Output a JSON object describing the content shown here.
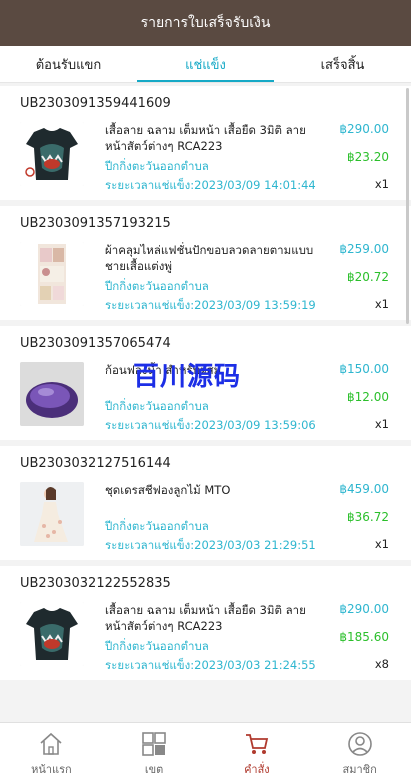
{
  "header": {
    "title": "รายการใบเสร็จรับเงิน"
  },
  "tabs": [
    {
      "label": "ต้อนรับแขก",
      "active": false
    },
    {
      "label": "แช่แข็ง",
      "active": true
    },
    {
      "label": "เสร็จสิ้น",
      "active": false
    }
  ],
  "orders": [
    {
      "id": "UB2303091359441609",
      "name": "เสื้อลาย ฉลาม เต็มหน้า เสื้อยืด 3มิติ ลายหน้าสัตว์ต่างๆ RCA223",
      "ship": "ปีกกิ่งตะวันออกตำบล",
      "time": "ระยะเวลาแช่แข็ง:2023/03/09 14:01:44",
      "price": "฿290.00",
      "commission": "฿23.20",
      "qty": "x1",
      "thumb_icon": "shark-shirt-image"
    },
    {
      "id": "UB2303091357193215",
      "name": "ผ้าคลุมไหล่แฟชั่นปักขอบลวดลายตามแบบ ชายเสื้อแต่งพู่",
      "ship": "ปีกกิ่งตะวันออกตำบล",
      "time": "ระยะเวลาแช่แข็ง:2023/03/09 13:59:19",
      "price": "฿259.00",
      "commission": "฿20.72",
      "qty": "x1",
      "thumb_icon": "shawl-image"
    },
    {
      "id": "UB2303091357065474",
      "name": "ก้อนฟองน้ำ สำหรับผสม",
      "ship": "ปีกกิ่งตะวันออกตำบล",
      "time": "ระยะเวลาแช่แข็ง:2023/03/09 13:59:06",
      "price": "฿150.00",
      "commission": "฿12.00",
      "qty": "x1",
      "thumb_icon": "sponge-image"
    },
    {
      "id": "UB2303032127516144",
      "name": "ชุดเดรสชีฟองลูกไม้ MTO",
      "ship": "ปีกกิ่งตะวันออกตำบล",
      "time": "ระยะเวลาแช่แข็ง:2023/03/03 21:29:51",
      "price": "฿459.00",
      "commission": "฿36.72",
      "qty": "x1",
      "thumb_icon": "dress-image"
    },
    {
      "id": "UB2303032122552835",
      "name": "เสื้อลาย ฉลาม เต็มหน้า เสื้อยืด 3มิติ ลายหน้าสัตว์ต่างๆ RCA223",
      "ship": "ปีกกิ่งตะวันออกตำบล",
      "time": "ระยะเวลาแช่แข็ง:2023/03/03 21:24:55",
      "price": "฿290.00",
      "commission": "฿185.60",
      "qty": "x8",
      "thumb_icon": "shark-shirt-image"
    }
  ],
  "watermark": "百川源码",
  "nav": [
    {
      "label": "หน้าแรก",
      "icon": "home-icon",
      "active": false
    },
    {
      "label": "เขต",
      "icon": "grid-icon",
      "active": false
    },
    {
      "label": "คำสั่ง",
      "icon": "cart-icon",
      "active": true
    },
    {
      "label": "สมาชิก",
      "icon": "user-icon",
      "active": false
    }
  ],
  "colors": {
    "header": "#5a4a41",
    "accent": "#16a9c6",
    "commission": "#2bbf2b",
    "nav_active": "#b03a2e"
  }
}
